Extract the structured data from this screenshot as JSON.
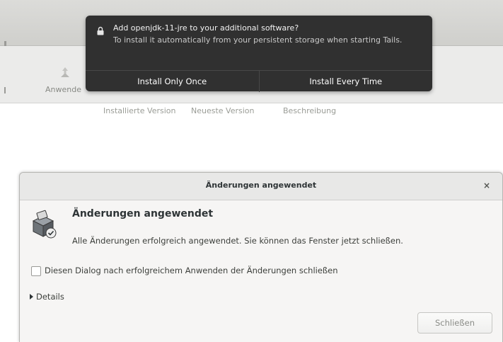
{
  "app": {
    "toolbar": {
      "apply_label": "Anwende"
    },
    "columns": {
      "installed_version": "Installierte Version",
      "latest_version": "Neueste Version",
      "description": "Beschreibung"
    }
  },
  "notification": {
    "title": "Add openjdk-11-jre to your additional software?",
    "body": "To install it automatically from your persistent storage when starting Tails.",
    "install_once_label": "Install Only Once",
    "install_always_label": "Install Every Time"
  },
  "dialog": {
    "window_title": "Änderungen angewendet",
    "close_symbol": "×",
    "heading": "Änderungen angewendet",
    "message": "Alle Änderungen erfolgreich angewendet. Sie können das Fenster jetzt schließen.",
    "checkbox_label": "Diesen Dialog nach erfolgreichem Anwenden der Änderungen schließen",
    "checkbox_checked": false,
    "details_label": "Details",
    "close_button_label": "Schließen"
  },
  "colors": {
    "notification_bg": "#303030",
    "dialog_bg": "#f6f5f4",
    "headerbar_bg": "#d4d4d1"
  },
  "icons": {
    "notification": "lock-icon",
    "toolbar_apply": "apply-changes-icon",
    "dialog": "software-package-icon",
    "close": "close-icon",
    "details": "expander-arrow-icon"
  }
}
